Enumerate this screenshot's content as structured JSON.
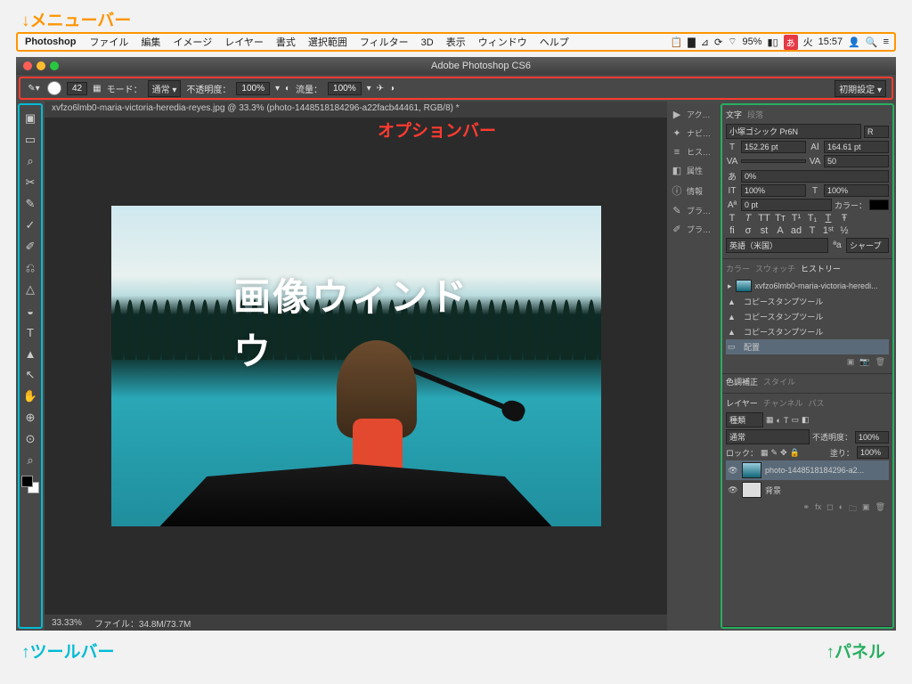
{
  "annotations": {
    "menubar": "↓メニューバー",
    "optionbar": "オプションバー",
    "optionbar_arrow": "↑",
    "toolbar": "↑ツールバー",
    "panels": "↑パネル"
  },
  "menubar": {
    "app": "Photoshop",
    "items": [
      "ファイル",
      "編集",
      "イメージ",
      "レイヤー",
      "書式",
      "選択範囲",
      "フィルター",
      "3D",
      "表示",
      "ウィンドウ",
      "ヘルプ"
    ],
    "status": {
      "battery": "95%",
      "ime": "あ",
      "day": "火",
      "time": "15:57"
    }
  },
  "window": {
    "title": "Adobe Photoshop CS6"
  },
  "optionbar": {
    "brush_size": "42",
    "mode_label": "モード：",
    "mode_value": "通常",
    "opacity_label": "不透明度：",
    "opacity_value": "100%",
    "flow_label": "流量：",
    "flow_value": "100%",
    "preset": "初期設定"
  },
  "document_tab": "xvfzo6lmb0-maria-victoria-heredia-reyes.jpg @ 33.3% (photo-1448518184296-a22facb44461, RGB/8) *",
  "canvas_label": "画像ウィンドウ",
  "statusbar": {
    "zoom": "33.33%",
    "filesize_label": "ファイル：",
    "filesize": "34.8M/73.7M"
  },
  "toolbar_icons": [
    "▣",
    "▭",
    "⌕",
    "✂",
    "✎",
    "✓",
    "✐",
    "⎌",
    "△",
    "◒",
    "T",
    "▲",
    "↖",
    "✋",
    "⊕",
    "⊙",
    "⌕"
  ],
  "panelcol": [
    {
      "gly": "▶",
      "label": "アク…"
    },
    {
      "gly": "✦",
      "label": "ナビ…"
    },
    {
      "gly": "≡",
      "label": "ヒス…"
    },
    {
      "gly": "◧",
      "label": "属性"
    },
    {
      "gly": "ⓘ",
      "label": "情報"
    },
    {
      "gly": "✎",
      "label": "ブラ…"
    },
    {
      "gly": "✐",
      "label": "ブラ…"
    }
  ],
  "character": {
    "tabs": [
      "文字",
      "段落"
    ],
    "font": "小塚ゴシック Pr6N",
    "style": "R",
    "size": "152.26 pt",
    "leading": "164.61 pt",
    "tracking": "50",
    "baseline": "0%",
    "hscale": "100%",
    "vscale": "100%",
    "shift": "0 pt",
    "color_label": "カラー：",
    "lang": "英語（米国）",
    "aa": "シャープ"
  },
  "swatch_tabs": [
    "カラー",
    "スウォッチ",
    "ヒストリー"
  ],
  "history": {
    "doc": "xvfzo6lmb0-maria-victoria-heredi...",
    "items": [
      "コピースタンプツール",
      "コピースタンプツール",
      "コピースタンプツール"
    ],
    "selected": "配置"
  },
  "adjust_tabs": [
    "色調補正",
    "スタイル"
  ],
  "layers": {
    "tabs": [
      "レイヤー",
      "チャンネル",
      "パス"
    ],
    "kind_label": "種類",
    "blend": "通常",
    "opacity_label": "不透明度：",
    "opacity": "100%",
    "lock_label": "ロック：",
    "fill_label": "塗り：",
    "fill": "100%",
    "rows": [
      {
        "name": "photo-1448518184296-a2...",
        "selected": true
      },
      {
        "name": "背景",
        "selected": false
      }
    ]
  }
}
